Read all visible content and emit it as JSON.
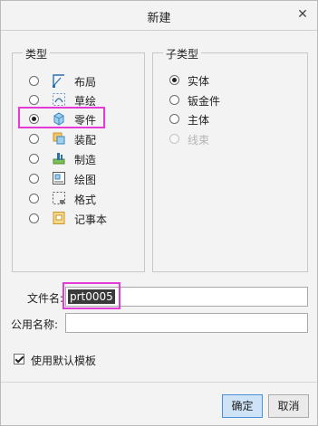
{
  "dialog": {
    "title": "新建"
  },
  "type_group": {
    "legend": "类型",
    "items": [
      {
        "label": "布局",
        "icon": "layout-icon",
        "selected": false
      },
      {
        "label": "草绘",
        "icon": "sketch-icon",
        "selected": false
      },
      {
        "label": "零件",
        "icon": "part-icon",
        "selected": true
      },
      {
        "label": "装配",
        "icon": "assembly-icon",
        "selected": false
      },
      {
        "label": "制造",
        "icon": "manufacturing-icon",
        "selected": false
      },
      {
        "label": "绘图",
        "icon": "drawing-icon",
        "selected": false
      },
      {
        "label": "格式",
        "icon": "format-icon",
        "selected": false
      },
      {
        "label": "记事本",
        "icon": "notebook-icon",
        "selected": false
      }
    ]
  },
  "subtype_group": {
    "legend": "子类型",
    "items": [
      {
        "label": "实体",
        "selected": true,
        "enabled": true
      },
      {
        "label": "钣金件",
        "selected": false,
        "enabled": true
      },
      {
        "label": "主体",
        "selected": false,
        "enabled": true
      },
      {
        "label": "线束",
        "selected": false,
        "enabled": false
      }
    ]
  },
  "filename": {
    "label": "文件名:",
    "value": "prt0005"
  },
  "common_name": {
    "label": "公用名称:",
    "value": ""
  },
  "default_template": {
    "label": "使用默认模板",
    "checked": true
  },
  "buttons": {
    "ok": "确定",
    "cancel": "取消"
  },
  "colors": {
    "highlight": "#e43bd8",
    "selection": "#3a3a3a",
    "ok_button": "#cfe3f7"
  }
}
